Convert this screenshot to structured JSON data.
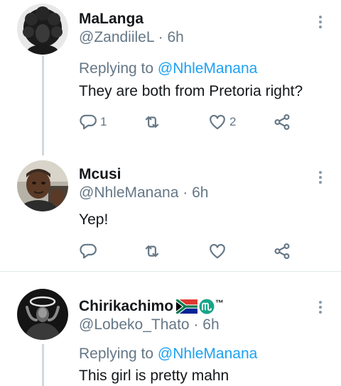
{
  "tweets": [
    {
      "display_name": "MaLanga",
      "handle": "@ZandiileL",
      "separator": "·",
      "time": "6h",
      "replying_prefix": "Replying to",
      "replying_to": "@NhleManana",
      "text": "They are both from Pretoria right?",
      "reply_count": "1",
      "retweet_count": "",
      "like_count": "2"
    },
    {
      "display_name": "Mcusi",
      "handle": "@NhleManana",
      "separator": "·",
      "time": "6h",
      "text": "Yep!",
      "reply_count": "",
      "retweet_count": "",
      "like_count": ""
    },
    {
      "display_name": "Chirikachimo",
      "name_badges": [
        "south-africa-flag-icon",
        "circle-m-logo-icon"
      ],
      "trademark": "™",
      "handle": "@Lobeko_Thato",
      "separator": "·",
      "time": "6h",
      "replying_prefix": "Replying to",
      "replying_to": "@NhleManana",
      "text": "This girl is pretty mahn"
    }
  ],
  "colors": {
    "text_primary": "#14171a",
    "text_secondary": "#657786",
    "mention": "#1da1f2",
    "icon": "#657786",
    "thread_line": "#cfd9de",
    "divider": "#e1e8ed",
    "badge_green": "#17a589"
  }
}
